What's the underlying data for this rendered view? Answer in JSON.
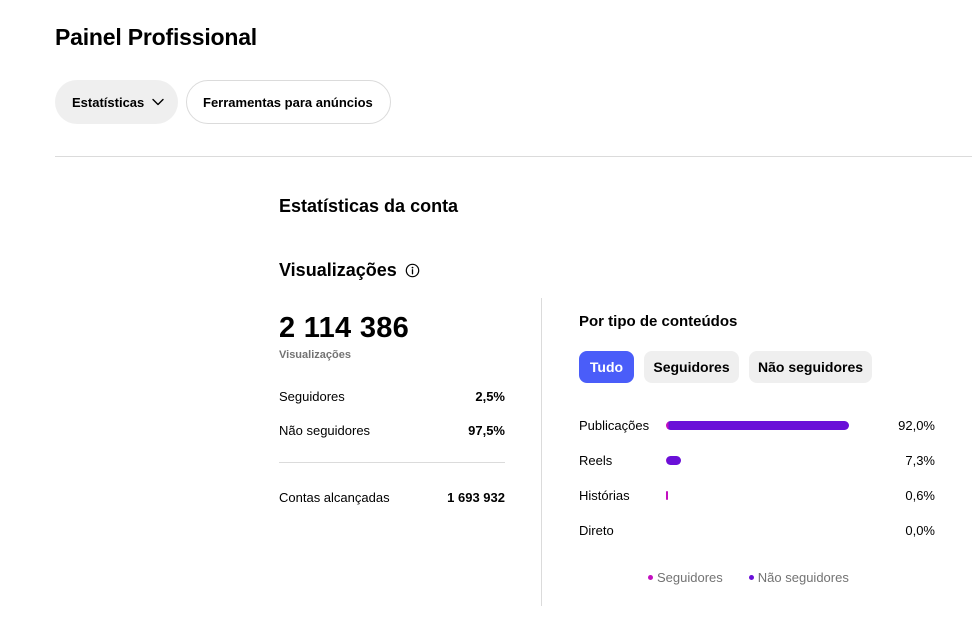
{
  "header": {
    "title": "Painel Profissional"
  },
  "tabs": [
    {
      "label": "Estatísticas"
    },
    {
      "label": "Ferramentas para anúncios"
    }
  ],
  "section": {
    "title": "Estatísticas da conta"
  },
  "views": {
    "title": "Visualizações",
    "total": "2 114 386",
    "caption": "Visualizações",
    "rows": [
      {
        "label": "Seguidores",
        "value": "2,5%"
      },
      {
        "label": "Não seguidores",
        "value": "97,5%"
      }
    ],
    "reach": {
      "label": "Contas alcançadas",
      "value": "1 693 932"
    }
  },
  "content_types": {
    "title": "Por tipo de conteúdos",
    "filters": [
      {
        "label": "Tudo",
        "active": true
      },
      {
        "label": "Seguidores",
        "active": false
      },
      {
        "label": "Não seguidores",
        "active": false
      }
    ],
    "items": [
      {
        "label": "Publicações",
        "percent_text": "92,0%",
        "followers_pct": 0.3,
        "nonfollowers_pct": 91.7
      },
      {
        "label": "Reels",
        "percent_text": "7,3%",
        "followers_pct": 0.2,
        "nonfollowers_pct": 7.1
      },
      {
        "label": "Histórias",
        "percent_text": "0,6%",
        "followers_pct": 0.6,
        "nonfollowers_pct": 0.0
      },
      {
        "label": "Direto",
        "percent_text": "0,0%",
        "followers_pct": 0.0,
        "nonfollowers_pct": 0.0
      }
    ],
    "legend": [
      {
        "label": "Seguidores",
        "color": "#c30fbf"
      },
      {
        "label": "Não seguidores",
        "color": "#6a10d8"
      }
    ]
  },
  "colors": {
    "accent": "#4a5df9",
    "followers": "#c30fbf",
    "nonfollowers": "#6a10d8",
    "divider": "#dbdbdb"
  }
}
